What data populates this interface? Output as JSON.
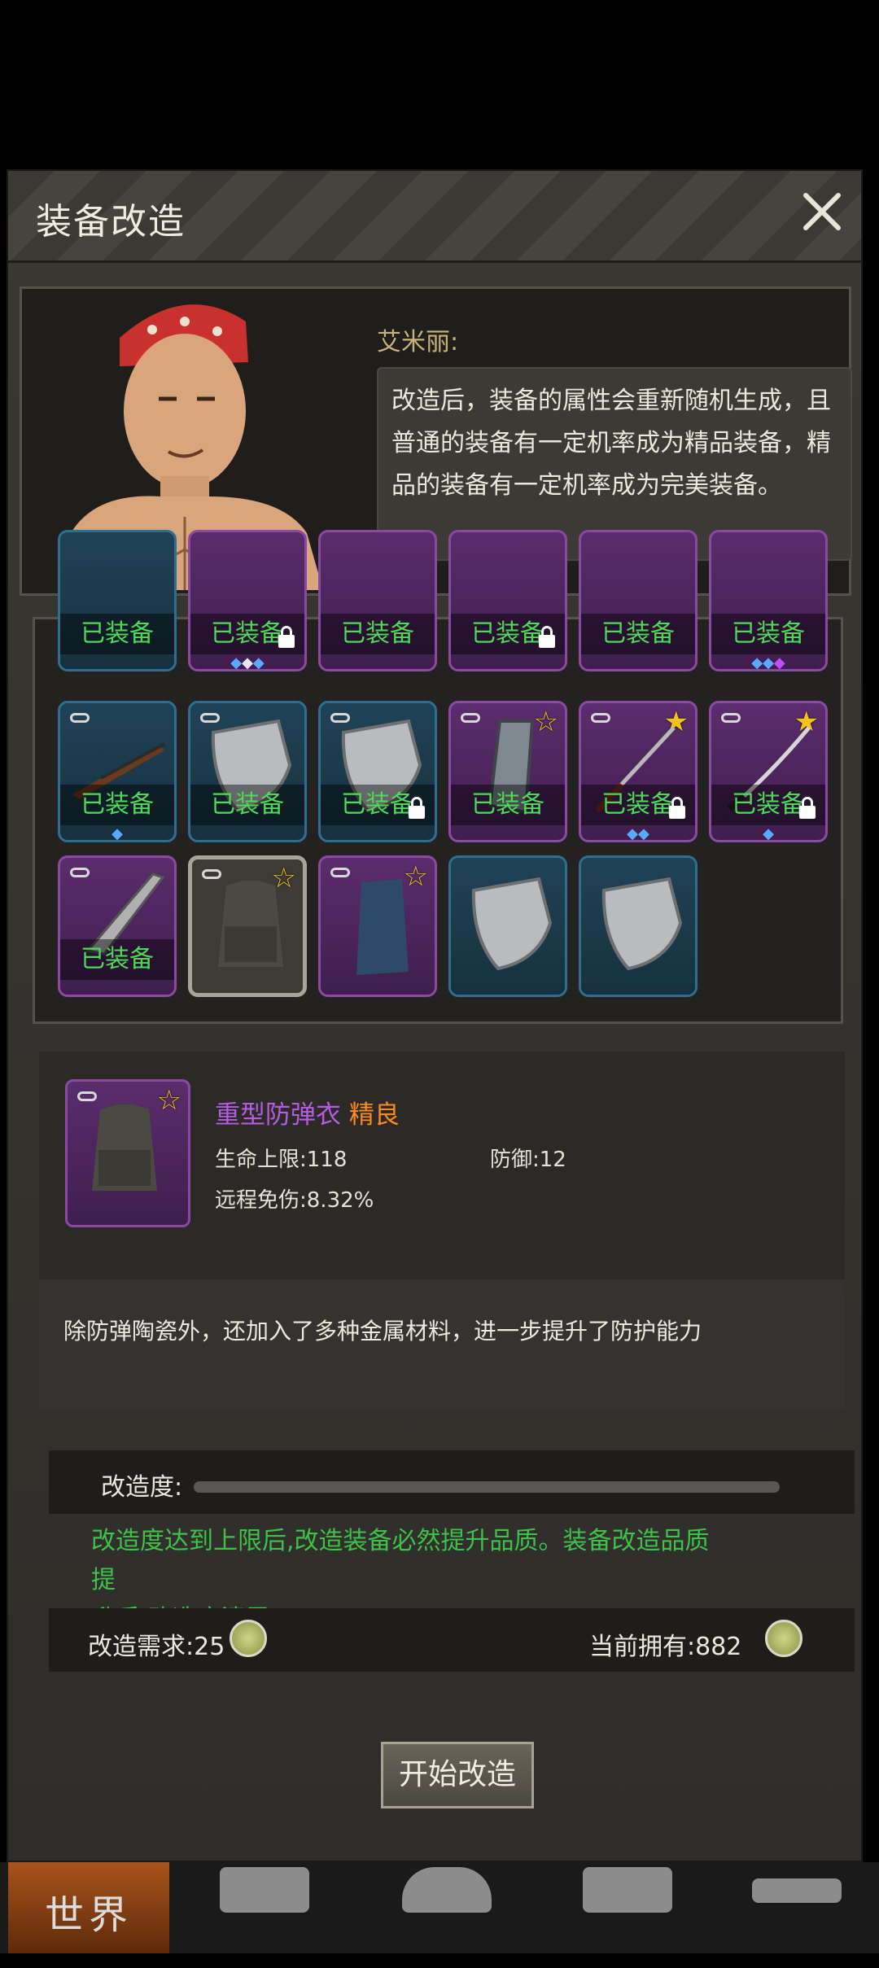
{
  "dialog": {
    "title": "装备改造"
  },
  "npc": {
    "speaker": "艾米丽:",
    "lines": [
      "改造后，装备的属性会重新随机生成，且",
      "普通的装备有一定机率成为精品装备，精",
      "品的装备有一定机率成为完美装备。"
    ]
  },
  "equipped_label": "已装备",
  "item": {
    "name": "重型防弹衣",
    "quality": "精良",
    "stats": {
      "hp_label": "生命上限:",
      "hp_value": "118",
      "def_label": "防御:",
      "def_value": "12",
      "ranged_label": "远程免伤:",
      "ranged_value": "8.32%"
    },
    "description": "除防弹陶瓷外，还加入了多种金属材料，进一步提升了防护能力"
  },
  "upgrade": {
    "progress_label": "改造度:",
    "progress_fraction": 0,
    "note_lines": [
      "改造度达到上限后,改造装备必然提升品质。装备改造品质提",
      "升后,改造度清零"
    ],
    "cost_label": "改造需求:",
    "cost_value": "25",
    "owned_label": "当前拥有:",
    "owned_value": "882",
    "start_button": "开始改造"
  },
  "nav": {
    "world": "世界"
  },
  "colors": {
    "equipped_text": "#4fd95a",
    "quality_orange": "#ff8a1e",
    "item_purple": "#b45de0",
    "note_green": "#3ec24a"
  }
}
